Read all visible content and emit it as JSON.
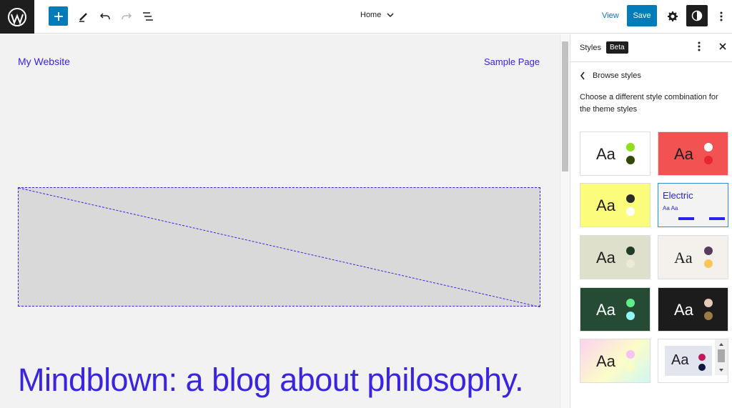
{
  "toolbar": {
    "document_title": "Home",
    "view_label": "View",
    "save_label": "Save"
  },
  "canvas": {
    "site_title": "My Website",
    "nav_link": "Sample Page",
    "heading": "Mindblown: a blog about philosophy."
  },
  "panel": {
    "title": "Styles",
    "badge": "Beta",
    "back_label": "Browse styles",
    "description": "Choose a different style combination for the theme styles"
  },
  "styles": [
    {
      "sample": "Aa",
      "bg": "#ffffff",
      "dot1": "#8fe01a",
      "dot2": "#2f4a08"
    },
    {
      "sample": "Aa",
      "bg": "#f25252",
      "dot1": "#ffffff",
      "dot2": "#e8262f"
    },
    {
      "sample": "Aa",
      "bg": "#fbfc7c",
      "dot1": "#2b2b2b",
      "dot2": "#ffffff"
    },
    {
      "sample": "Electric",
      "sub": "Aa Aa",
      "bg": "#f3f3f3",
      "accent": "#2b20ef"
    },
    {
      "sample": "Aa",
      "bg": "#dfe0cb",
      "dot1": "#203d28",
      "dot2": "#eee9d8"
    },
    {
      "sample": "Aa",
      "bg": "#f4f1ec",
      "dot1": "#5a3b5c",
      "dot2": "#fcc55b"
    },
    {
      "sample": "Aa",
      "bg": "#254b35",
      "dot1": "#5ef08a",
      "dot2": "#8ff7f5"
    },
    {
      "sample": "Aa",
      "bg": "#1c1c1c",
      "dot1": "#e8c8b6",
      "dot2": "#9d7a46"
    },
    {
      "sample": "Aa",
      "bg": "gradient",
      "dot1": "#f5c4f4",
      "dot2": "#fbfbc4"
    },
    {
      "sample": "Aa",
      "bg": "#e3e5ee",
      "dot1": "#c2155a",
      "dot2": "#0e1640"
    }
  ]
}
